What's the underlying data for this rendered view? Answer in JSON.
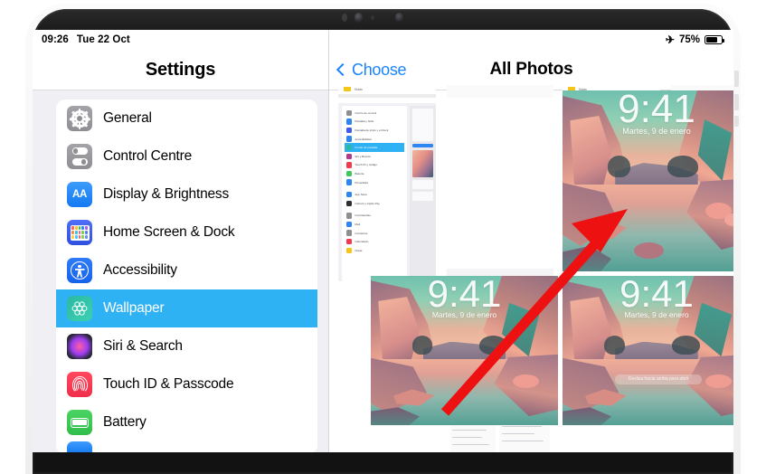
{
  "status_bar": {
    "time": "09:26",
    "date": "Tue 22 Oct",
    "battery_percent": "75%",
    "airplane_icon": "airplane-icon",
    "battery_icon": "battery-icon"
  },
  "settings_pane": {
    "title": "Settings",
    "items": [
      {
        "label": "General",
        "icon": "gear-icon",
        "selected": false
      },
      {
        "label": "Control Centre",
        "icon": "toggles-icon",
        "selected": false
      },
      {
        "label": "Display & Brightness",
        "icon": "aa-icon",
        "selected": false
      },
      {
        "label": "Home Screen & Dock",
        "icon": "app-grid-icon",
        "selected": false
      },
      {
        "label": "Accessibility",
        "icon": "accessibility-icon",
        "selected": false
      },
      {
        "label": "Wallpaper",
        "icon": "flower-icon",
        "selected": true
      },
      {
        "label": "Siri & Search",
        "icon": "siri-orb-icon",
        "selected": false
      },
      {
        "label": "Touch ID & Passcode",
        "icon": "fingerprint-icon",
        "selected": false
      },
      {
        "label": "Battery",
        "icon": "battery-icon",
        "selected": false
      }
    ],
    "selected_accent": "#2fb2f4"
  },
  "photos_pane": {
    "back_label": "Choose",
    "back_icon": "chevron-left-icon",
    "title": "All Photos",
    "link_color": "#1a84ff",
    "partial_top_row_label": "Notas",
    "thumbnails": [
      {
        "kind": "settings-screenshot-es",
        "name": "thumb-settings-screenshot",
        "groups": [
          {
            "rows": [
              {
                "label": "Centro de control",
                "color": "#8e8e93",
                "highlighted": false
              },
              {
                "label": "Pantalla y brillo",
                "color": "#2f86f3",
                "highlighted": false
              },
              {
                "label": "Pantalla de inicio y el Dock",
                "color": "#3f5bf0",
                "highlighted": false
              },
              {
                "label": "Accesibilidad",
                "color": "#2f86f3",
                "highlighted": false
              },
              {
                "label": "Fondo de pantalla",
                "color": "#2bb8a4",
                "highlighted": true
              },
              {
                "label": "Siri y Buscar",
                "color": "#b03a8e",
                "highlighted": false
              },
              {
                "label": "Touch ID y código",
                "color": "#f2394f",
                "highlighted": false
              },
              {
                "label": "Batería",
                "color": "#3ec75a",
                "highlighted": false
              },
              {
                "label": "Privacidad",
                "color": "#2f86f3",
                "highlighted": false
              }
            ]
          },
          {
            "rows": [
              {
                "label": "App Store",
                "color": "#2f86f3",
                "highlighted": false
              },
              {
                "label": "Cartera y Apple Pay",
                "color": "#2e2e33",
                "highlighted": false
              }
            ]
          },
          {
            "rows": [
              {
                "label": "Contraseñas",
                "color": "#8e8e93",
                "highlighted": false
              },
              {
                "label": "Mail",
                "color": "#2f86f3",
                "highlighted": false
              },
              {
                "label": "Contactos",
                "color": "#8e8e93",
                "highlighted": false
              },
              {
                "label": "Calendario",
                "color": "#f2394f",
                "highlighted": false
              },
              {
                "label": "Notas",
                "color": "#f5c518",
                "highlighted": false
              }
            ]
          }
        ]
      },
      {
        "kind": "mosaic-screenshot",
        "name": "thumb-mosaic-screenshot"
      },
      {
        "kind": "wallpaper",
        "name": "thumb-wallpaper-selected",
        "time": "9:41",
        "date": "Martes, 9 de enero",
        "notification": "",
        "selected": true
      },
      {
        "kind": "wallpaper",
        "name": "thumb-wallpaper-bottom-left",
        "time": "9:41",
        "date": "Martes, 9 de enero",
        "notification": "",
        "selected": false
      },
      {
        "kind": "wallpaper",
        "name": "thumb-wallpaper-bottom-right",
        "time": "9:41",
        "date": "Martes, 9 de enero",
        "notification": "Desliza hacia arriba para abrir",
        "selected": false
      }
    ]
  },
  "annotation": {
    "arrow_color": "#ee1111",
    "points_to": "thumb-wallpaper-selected"
  }
}
